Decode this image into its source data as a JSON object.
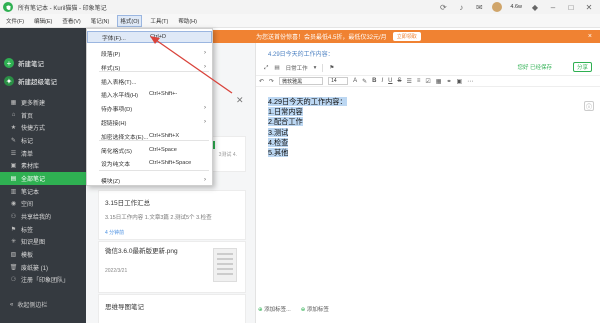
{
  "window": {
    "title": "所有笔记本 - Kuril猫猫 - 印象笔记",
    "score": "4.6w"
  },
  "menubar": [
    "文件(F)",
    "编辑(E)",
    "查看(V)",
    "笔记(N)",
    "格式(O)",
    "工具(T)",
    "帮助(H)"
  ],
  "banner": {
    "text": "为您送首份惊喜！会员最低4.5折，最低仅32元/月",
    "button": "立即领取",
    "close": "×"
  },
  "sidebar": {
    "new_note": "新建笔记",
    "new_super_note": "新建超级笔记",
    "items": [
      {
        "label": "更多新建",
        "icon": "▦"
      },
      {
        "label": "首页",
        "icon": "⌂"
      },
      {
        "label": "快捷方式",
        "icon": "★"
      },
      {
        "label": "标记",
        "icon": "✎"
      },
      {
        "label": "清单",
        "icon": "☰"
      },
      {
        "label": "素材库",
        "icon": "▣"
      },
      {
        "label": "全部笔记",
        "icon": "▤"
      },
      {
        "label": "笔记本",
        "icon": "▥"
      },
      {
        "label": "空间",
        "icon": "◉"
      },
      {
        "label": "共享给我的",
        "icon": "⚇"
      },
      {
        "label": "标签",
        "icon": "⚑"
      },
      {
        "label": "知识星图",
        "icon": "✳"
      },
      {
        "label": "模板",
        "icon": "▧"
      },
      {
        "label": "废纸篓 (1)",
        "icon": "🗑"
      },
      {
        "label": "注册「印象团队」",
        "icon": "⚆"
      }
    ],
    "active_index": 6,
    "bottom": "收起侧边栏"
  },
  "dropdown": {
    "items": [
      {
        "label": "字体(F)...",
        "shortcut": "Ctrl+D",
        "arrow": false,
        "highlight": true
      },
      {
        "label": "段落(P)",
        "shortcut": "",
        "arrow": true
      },
      {
        "label": "样式(S)",
        "shortcut": "",
        "arrow": true
      },
      {
        "label": "插入表格(T)...",
        "shortcut": "",
        "arrow": false
      },
      {
        "label": "插入水平线(H)",
        "shortcut": "Ctrl+Shift+-",
        "arrow": false
      },
      {
        "label": "待办事项(D)",
        "shortcut": "",
        "arrow": true
      },
      {
        "label": "超链接(H)",
        "shortcut": "",
        "arrow": true
      },
      {
        "label": "加密选择文本(E)...",
        "shortcut": "Ctrl+Shift+X",
        "arrow": false
      },
      {
        "label": "简化格式(S)",
        "shortcut": "Ctrl+Space",
        "arrow": false
      },
      {
        "label": "设为纯文本",
        "shortcut": "Ctrl+Shift+Space",
        "arrow": false
      },
      {
        "label": "模块(Z)",
        "shortcut": "",
        "arrow": true
      }
    ]
  },
  "notelist": {
    "cards": [
      {
        "title": "",
        "snippet": "",
        "meta": "",
        "partial_text": "3测试 4.",
        "partial_badge": "1"
      },
      {
        "title": "3.15日工作汇总",
        "snippet": "3.15日工作内容 1.文章3篇 2.测试5个 3.检查",
        "meta": "4 分钟前"
      },
      {
        "title": "微信3.6.0最新版更新.png",
        "snippet": "",
        "meta": "2022/3/21"
      },
      {
        "title": "思维导图笔记",
        "snippet": "",
        "meta": ""
      }
    ]
  },
  "editor": {
    "title": "4.29日今天的工作内容：",
    "notebook": "日常工作",
    "status": "您好 已经保存",
    "share": "分享",
    "font": "微软雅黑",
    "size": "14",
    "lines": [
      "4.29日今天的工作内容：",
      "1.日常内容",
      "2.配合工作",
      "3.测试",
      "4.检查",
      "5.其他"
    ],
    "bottom_add_tag": "添加标签...",
    "bottom_label": "添加标签"
  },
  "colors": {
    "accent": "#2fb052",
    "banner": "#f08232",
    "sidebar": "#353a40",
    "highlight": "#bcd7f2",
    "arrow": "#d9433b"
  }
}
